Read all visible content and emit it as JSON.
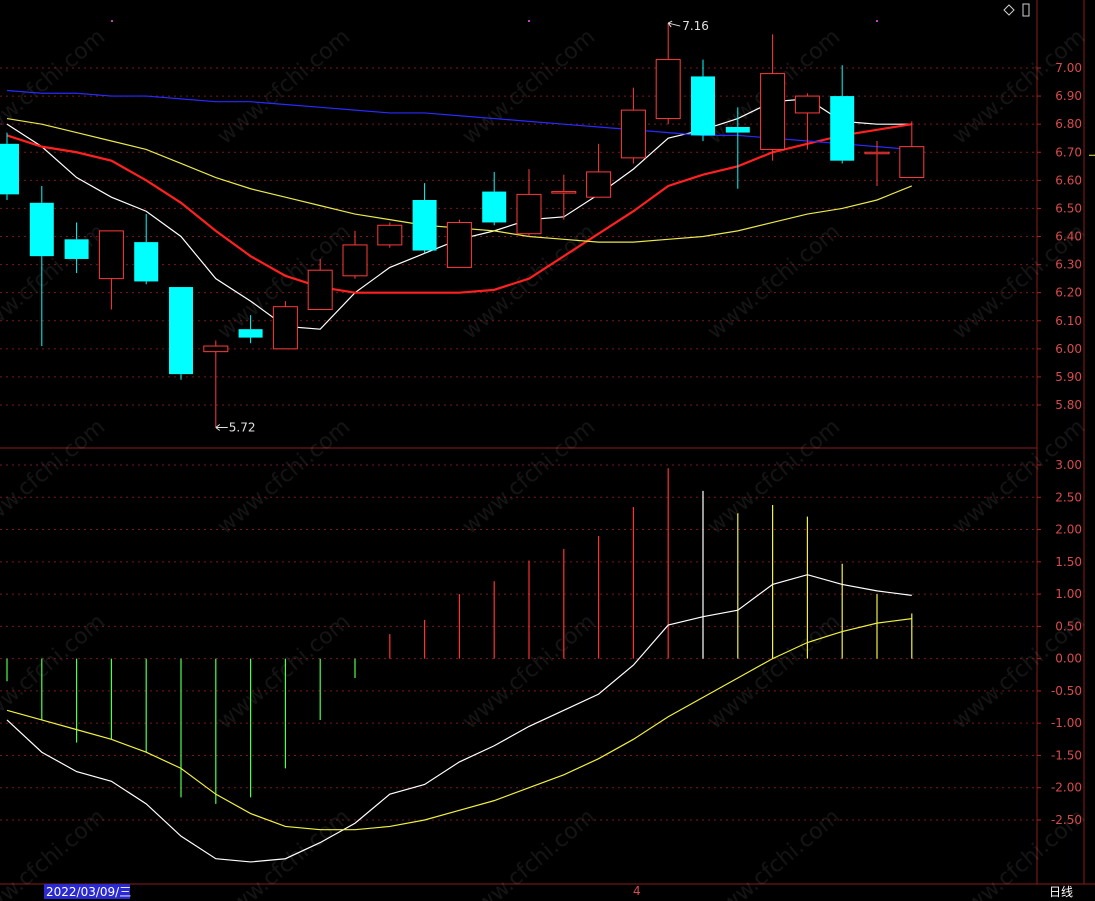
{
  "chart_data": [
    {
      "type": "candlestick",
      "title": "",
      "ylim": [
        5.72,
        7.16
      ],
      "ticks": [
        "5.80",
        "5.90",
        "6.00",
        "6.10",
        "6.20",
        "6.30",
        "6.40",
        "6.50",
        "6.60",
        "6.70",
        "6.80",
        "6.90",
        "7.00"
      ],
      "high_label": "7.16",
      "low_label": "5.72",
      "right_edge_marker": "6.70",
      "candles": [
        {
          "o": 6.73,
          "h": 6.77,
          "l": 6.53,
          "c": 6.55
        },
        {
          "o": 6.52,
          "h": 6.58,
          "l": 6.01,
          "c": 6.33
        },
        {
          "o": 6.39,
          "h": 6.45,
          "l": 6.27,
          "c": 6.32
        },
        {
          "o": 6.25,
          "h": 6.42,
          "l": 6.14,
          "c": 6.42
        },
        {
          "o": 6.38,
          "h": 6.48,
          "l": 6.23,
          "c": 6.24
        },
        {
          "o": 6.22,
          "h": 6.22,
          "l": 5.89,
          "c": 5.91
        },
        {
          "o": 5.99,
          "h": 6.03,
          "l": 5.72,
          "c": 6.01
        },
        {
          "o": 6.07,
          "h": 6.12,
          "l": 6.02,
          "c": 6.04
        },
        {
          "o": 6.0,
          "h": 6.17,
          "l": 6.0,
          "c": 6.15
        },
        {
          "o": 6.14,
          "h": 6.32,
          "l": 6.14,
          "c": 6.28
        },
        {
          "o": 6.26,
          "h": 6.42,
          "l": 6.25,
          "c": 6.37
        },
        {
          "o": 6.37,
          "h": 6.45,
          "l": 6.36,
          "c": 6.44
        },
        {
          "o": 6.53,
          "h": 6.59,
          "l": 6.34,
          "c": 6.35
        },
        {
          "o": 6.29,
          "h": 6.46,
          "l": 6.29,
          "c": 6.45
        },
        {
          "o": 6.56,
          "h": 6.63,
          "l": 6.44,
          "c": 6.45
        },
        {
          "o": 6.41,
          "h": 6.64,
          "l": 6.4,
          "c": 6.55
        },
        {
          "o": 6.56,
          "h": 6.62,
          "l": 6.46,
          "c": 6.56
        },
        {
          "o": 6.54,
          "h": 6.73,
          "l": 6.54,
          "c": 6.63
        },
        {
          "o": 6.68,
          "h": 6.93,
          "l": 6.66,
          "c": 6.85
        },
        {
          "o": 6.82,
          "h": 7.16,
          "l": 6.8,
          "c": 7.03
        },
        {
          "o": 6.97,
          "h": 7.03,
          "l": 6.74,
          "c": 6.76
        },
        {
          "o": 6.79,
          "h": 6.86,
          "l": 6.57,
          "c": 6.77
        },
        {
          "o": 6.71,
          "h": 7.12,
          "l": 6.67,
          "c": 6.98
        },
        {
          "o": 6.84,
          "h": 6.91,
          "l": 6.71,
          "c": 6.9
        },
        {
          "o": 6.9,
          "h": 7.01,
          "l": 6.66,
          "c": 6.67
        },
        {
          "o": 6.7,
          "h": 6.74,
          "l": 6.58,
          "c": 6.7
        },
        {
          "o": 6.61,
          "h": 6.81,
          "l": 6.61,
          "c": 6.72
        }
      ],
      "series": [
        {
          "color": "#ffffff",
          "values": [
            6.8,
            6.72,
            6.61,
            6.54,
            6.49,
            6.4,
            6.25,
            6.17,
            6.08,
            6.07,
            6.2,
            6.29,
            6.34,
            6.39,
            6.42,
            6.46,
            6.47,
            6.55,
            6.64,
            6.75,
            6.78,
            6.82,
            6.88,
            6.89,
            6.81,
            6.8,
            6.8
          ]
        },
        {
          "color": "#ff2020",
          "values": [
            6.76,
            6.72,
            6.7,
            6.67,
            6.6,
            6.52,
            6.42,
            6.33,
            6.26,
            6.22,
            6.2,
            6.2,
            6.2,
            6.2,
            6.21,
            6.25,
            6.33,
            6.41,
            6.49,
            6.58,
            6.62,
            6.65,
            6.7,
            6.73,
            6.76,
            6.78,
            6.8
          ]
        },
        {
          "color": "#e8e84a",
          "values": [
            6.82,
            6.8,
            6.77,
            6.74,
            6.71,
            6.66,
            6.61,
            6.57,
            6.54,
            6.51,
            6.48,
            6.46,
            6.44,
            6.43,
            6.42,
            6.4,
            6.39,
            6.38,
            6.38,
            6.39,
            6.4,
            6.42,
            6.45,
            6.48,
            6.5,
            6.53,
            6.58
          ]
        },
        {
          "color": "#2a2aff",
          "values": [
            6.92,
            6.91,
            6.91,
            6.9,
            6.9,
            6.89,
            6.88,
            6.88,
            6.87,
            6.86,
            6.85,
            6.84,
            6.84,
            6.83,
            6.82,
            6.81,
            6.8,
            6.79,
            6.78,
            6.77,
            6.76,
            6.76,
            6.75,
            6.74,
            6.73,
            6.72,
            6.71
          ]
        }
      ]
    },
    {
      "type": "macd",
      "title": "",
      "ylim": [
        -3.2,
        3.2
      ],
      "ticks": [
        "3.00",
        "2.50",
        "2.00",
        "1.50",
        "1.00",
        "0.50",
        "0.00",
        "-0.50",
        "-1.00",
        "-1.50",
        "-2.00",
        "-2.50"
      ],
      "histogram": [
        -0.35,
        -0.95,
        -1.3,
        -1.25,
        -1.45,
        -2.15,
        -2.25,
        -2.15,
        -1.7,
        -0.95,
        -0.3,
        0.38,
        0.6,
        1.0,
        1.2,
        1.52,
        1.7,
        1.9,
        2.35,
        2.95,
        2.6,
        2.25,
        2.38,
        2.2,
        1.47,
        1.0,
        0.7
      ],
      "series": [
        {
          "color": "#ffffff",
          "values": [
            -0.95,
            -1.45,
            -1.75,
            -1.9,
            -2.25,
            -2.75,
            -3.1,
            -3.15,
            -3.1,
            -2.85,
            -2.55,
            -2.1,
            -1.95,
            -1.6,
            -1.35,
            -1.05,
            -0.8,
            -0.55,
            -0.1,
            0.52,
            0.65,
            0.75,
            1.15,
            1.3,
            1.15,
            1.05,
            0.98
          ]
        },
        {
          "color": "#f0f040",
          "values": [
            -0.8,
            -0.95,
            -1.1,
            -1.25,
            -1.45,
            -1.7,
            -2.1,
            -2.4,
            -2.6,
            -2.65,
            -2.65,
            -2.6,
            -2.5,
            -2.35,
            -2.2,
            -2.0,
            -1.8,
            -1.55,
            -1.25,
            -0.9,
            -0.6,
            -0.3,
            0.0,
            0.25,
            0.42,
            0.55,
            0.62
          ]
        }
      ]
    }
  ],
  "footer": {
    "date_label": "2022/03/09/三",
    "month_marker": "4",
    "period_label": "日线"
  }
}
